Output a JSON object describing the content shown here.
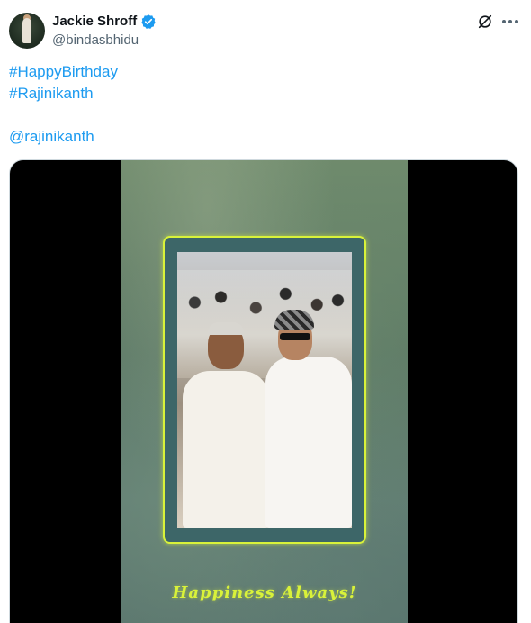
{
  "author": {
    "display_name": "Jackie Shroff",
    "handle": "@bindasbhidu",
    "verified": true
  },
  "tweet": {
    "lines": [
      "#HappyBirthday",
      "#Rajinikanth",
      "",
      "@rajinikanth"
    ]
  },
  "media": {
    "caption": "Happiness Always!"
  },
  "colors": {
    "link": "#1d9bf0",
    "verified": "#1d9bf0",
    "caption": "#d9f23a",
    "frame_border": "#d9f23a"
  },
  "icons": {
    "verified": "verified-badge-icon",
    "grok": "grok-icon",
    "more": "more-icon"
  }
}
